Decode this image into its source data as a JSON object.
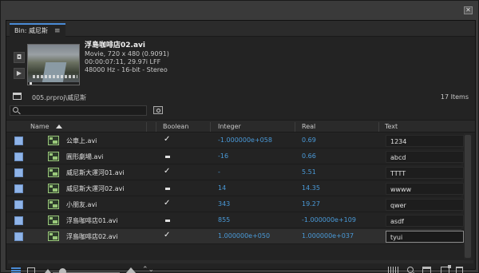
{
  "window": {
    "close_glyph": "✕"
  },
  "tab": {
    "label": "Bin: 威尼斯",
    "menu_glyph": "≡"
  },
  "preview": {
    "poster_icon": "camera-icon",
    "play_icon": "play-icon",
    "clip_name": "浮島咖啡店02.avi",
    "format": "Movie, 720 x 480 (0.9091)",
    "duration": "00:00:07:11, 29.97i LFF",
    "audio": "48000 Hz - 16-bit - Stereo"
  },
  "path": {
    "text": "005.prproj\\威尼斯",
    "items": "17 Items"
  },
  "search": {
    "value": "",
    "placeholder": ""
  },
  "columns": {
    "name": "Name",
    "boolean": "Boolean",
    "integer": "Integer",
    "real": "Real",
    "text": "Text"
  },
  "label_color": "#8fb4e8",
  "accent_color": "#4a8bd6",
  "value_color": "#4a9ad8",
  "rows": [
    {
      "name": "公車上.avi",
      "boolean": true,
      "integer": "-1.000000e+058",
      "real": "0.69",
      "text": "1234"
    },
    {
      "name": "圓形劇場.avi",
      "boolean": false,
      "integer": "-16",
      "real": "0.66",
      "text": "abcd"
    },
    {
      "name": "威尼斯大運河01.avi",
      "boolean": true,
      "integer": "-",
      "real": "5.51",
      "text": "TTTT"
    },
    {
      "name": "威尼斯大運河02.avi",
      "boolean": false,
      "integer": "14",
      "real": "14.35",
      "text": "wwww"
    },
    {
      "name": "小朋友.avi",
      "boolean": true,
      "integer": "343",
      "real": "19.27",
      "text": "qwer"
    },
    {
      "name": "浮島咖啡店01.avi",
      "boolean": false,
      "integer": "855",
      "real": "-1.000000e+109",
      "text": "asdf"
    },
    {
      "name": "浮島咖啡店02.avi",
      "boolean": true,
      "integer": "1.000000e+050",
      "real": "1.000000e+037",
      "text": "tyui",
      "selected": true
    }
  ],
  "toolbar": {
    "sort_glyph": "⌃⌄"
  }
}
